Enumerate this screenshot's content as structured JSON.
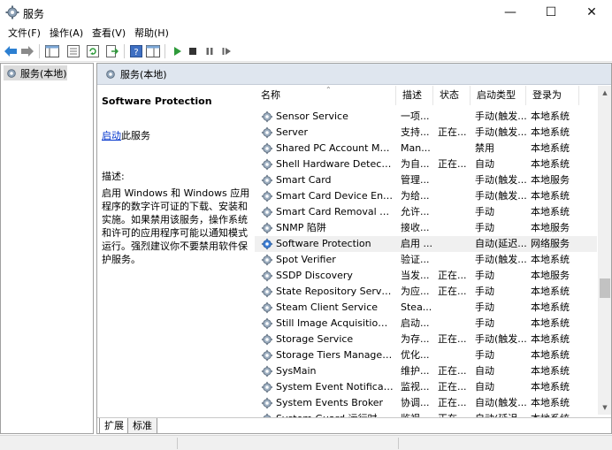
{
  "window": {
    "title": "服务",
    "minimize_glyph": "—",
    "maximize_glyph": "☐",
    "close_glyph": "✕"
  },
  "menu": [
    "文件(F)",
    "操作(A)",
    "查看(V)",
    "帮助(H)"
  ],
  "toolbar_icons": [
    "back-icon",
    "forward-icon",
    "show-hide-tree-icon",
    "properties-icon",
    "refresh-icon",
    "export-list-icon",
    "help-icon",
    "show-pane-icon",
    "start-service-icon",
    "stop-service-icon",
    "pause-service-icon",
    "restart-service-icon"
  ],
  "tree": {
    "root_label": "服务(本地)"
  },
  "pane": {
    "header": "服务(本地)",
    "selected_service": "Software Protection",
    "action_link": "启动",
    "action_suffix": "此服务",
    "desc_label": "描述:",
    "desc_text": "启用 Windows 和 Windows 应用程序的数字许可证的下载、安装和实施。如果禁用该服务，操作系统和许可的应用程序可能以通知模式运行。强烈建议你不要禁用软件保护服务。"
  },
  "columns": {
    "name": "名称",
    "description": "描述",
    "status": "状态",
    "startup": "启动类型",
    "logon": "登录为"
  },
  "services": [
    {
      "name": "Sensor Service",
      "desc": "一项...",
      "status": "",
      "startup": "手动(触发...",
      "logon": "本地系统"
    },
    {
      "name": "Server",
      "desc": "支持...",
      "status": "正在...",
      "startup": "手动(触发...",
      "logon": "本地系统"
    },
    {
      "name": "Shared PC Account Manager",
      "desc": "Man...",
      "status": "",
      "startup": "禁用",
      "logon": "本地系统"
    },
    {
      "name": "Shell Hardware Detection",
      "desc": "为自...",
      "status": "正在...",
      "startup": "自动",
      "logon": "本地系统"
    },
    {
      "name": "Smart Card",
      "desc": "管理...",
      "status": "",
      "startup": "手动(触发...",
      "logon": "本地服务"
    },
    {
      "name": "Smart Card Device Enumer...",
      "desc": "为给...",
      "status": "",
      "startup": "手动(触发...",
      "logon": "本地系统"
    },
    {
      "name": "Smart Card Removal Policy",
      "desc": "允许...",
      "status": "",
      "startup": "手动",
      "logon": "本地系统"
    },
    {
      "name": "SNMP 陷阱",
      "desc": "接收...",
      "status": "",
      "startup": "手动",
      "logon": "本地服务"
    },
    {
      "name": "Software Protection",
      "desc": "启用 ...",
      "status": "",
      "startup": "自动(延迟...",
      "logon": "网络服务",
      "selected": true
    },
    {
      "name": "Spot Verifier",
      "desc": "验证...",
      "status": "",
      "startup": "手动(触发...",
      "logon": "本地系统"
    },
    {
      "name": "SSDP Discovery",
      "desc": "当发...",
      "status": "正在...",
      "startup": "手动",
      "logon": "本地服务"
    },
    {
      "name": "State Repository Service",
      "desc": "为应...",
      "status": "正在...",
      "startup": "手动",
      "logon": "本地系统"
    },
    {
      "name": "Steam Client Service",
      "desc": "Stea...",
      "status": "",
      "startup": "手动",
      "logon": "本地系统"
    },
    {
      "name": "Still Image Acquisition Eve...",
      "desc": "启动...",
      "status": "",
      "startup": "手动",
      "logon": "本地系统"
    },
    {
      "name": "Storage Service",
      "desc": "为存...",
      "status": "正在...",
      "startup": "手动(触发...",
      "logon": "本地系统"
    },
    {
      "name": "Storage Tiers Management",
      "desc": "优化...",
      "status": "",
      "startup": "手动",
      "logon": "本地系统"
    },
    {
      "name": "SysMain",
      "desc": "维护...",
      "status": "正在...",
      "startup": "自动",
      "logon": "本地系统"
    },
    {
      "name": "System Event Notification ...",
      "desc": "监视...",
      "status": "正在...",
      "startup": "自动",
      "logon": "本地系统"
    },
    {
      "name": "System Events Broker",
      "desc": "协调...",
      "status": "正在...",
      "startup": "自动(触发...",
      "logon": "本地系统"
    },
    {
      "name": "System Guard 运行时监视...",
      "desc": "监视...",
      "status": "正在...",
      "startup": "自动(延迟...",
      "logon": "本地系统"
    }
  ],
  "tabs": [
    "扩展",
    "标准"
  ],
  "colors": {
    "header_band": "#dfe6ef",
    "link": "#0033cc",
    "selected_row": "#f0f0f0"
  }
}
